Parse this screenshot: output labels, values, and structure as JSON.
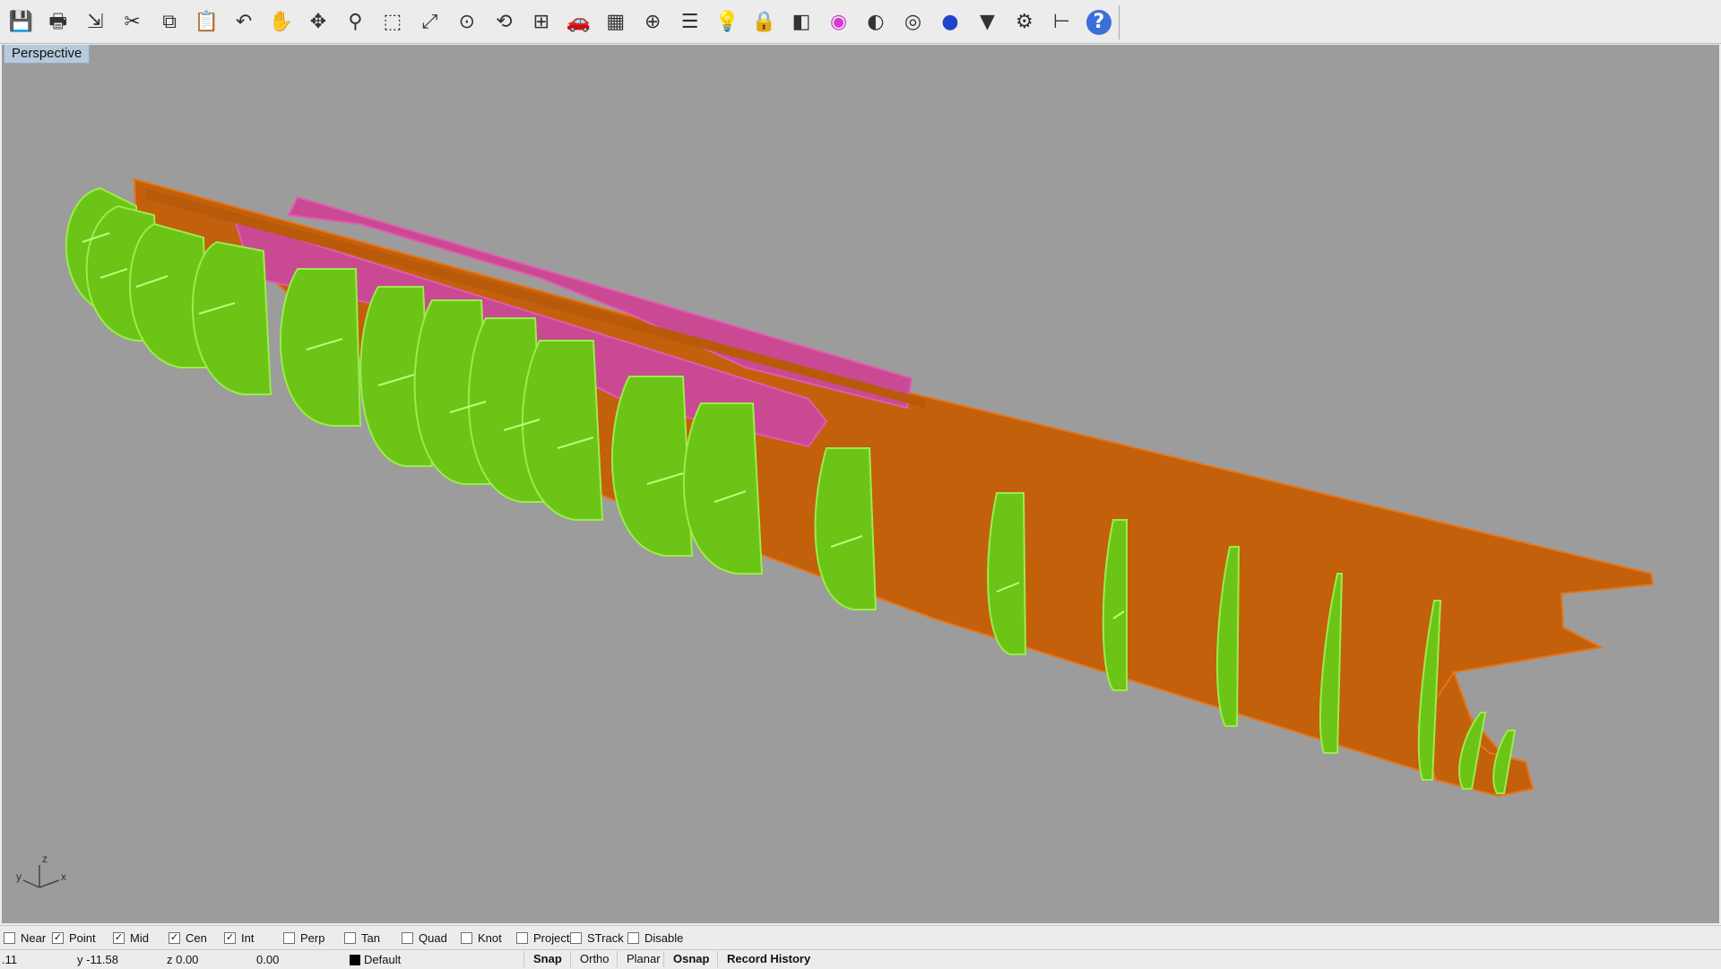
{
  "toolbar": {
    "icons": [
      "save-icon",
      "print-icon",
      "export-icon",
      "cut-icon",
      "copy-icon",
      "paste-icon",
      "undo-icon",
      "pan-icon",
      "rotate-view-icon",
      "zoom-dynamic-icon",
      "zoom-window-icon",
      "zoom-extents-icon",
      "zoom-selected-icon",
      "undo-view-icon",
      "four-viewports-icon",
      "car-icon",
      "grid-mesh-icon",
      "point-icon",
      "layers-icon",
      "light-bulb-icon",
      "lock-icon",
      "shaded-icon",
      "color-wheel-icon",
      "rendered-sphere-icon",
      "wireframe-sphere-icon",
      "blue-sphere-icon",
      "select-filter-icon",
      "options-gear-icon",
      "dimension-icon",
      "help-icon"
    ]
  },
  "viewport": {
    "title": "Perspective",
    "background": "#9c9c9c",
    "axis": {
      "x": "x",
      "y": "y",
      "z": "z"
    },
    "colors": {
      "frames": "#6cc417",
      "keel": "#c2600c",
      "stringers": "#c94a92"
    }
  },
  "osnap": {
    "items": [
      {
        "label": "Near",
        "checked": false
      },
      {
        "label": "Point",
        "checked": true
      },
      {
        "label": "Mid",
        "checked": true
      },
      {
        "label": "Cen",
        "checked": true
      },
      {
        "label": "Int",
        "checked": true
      },
      {
        "label": "Perp",
        "checked": false
      },
      {
        "label": "Tan",
        "checked": false
      },
      {
        "label": "Quad",
        "checked": false
      },
      {
        "label": "Knot",
        "checked": false
      },
      {
        "label": "Project",
        "checked": false
      },
      {
        "label": "STrack",
        "checked": false
      },
      {
        "label": "Disable",
        "checked": false
      }
    ]
  },
  "status": {
    "x": ".11",
    "y": "y -11.58",
    "z": "z 0.00",
    "extra": "0.00",
    "layer": "Default",
    "panes": [
      "Snap",
      "Ortho",
      "Planar",
      "Osnap",
      "Record History"
    ]
  }
}
